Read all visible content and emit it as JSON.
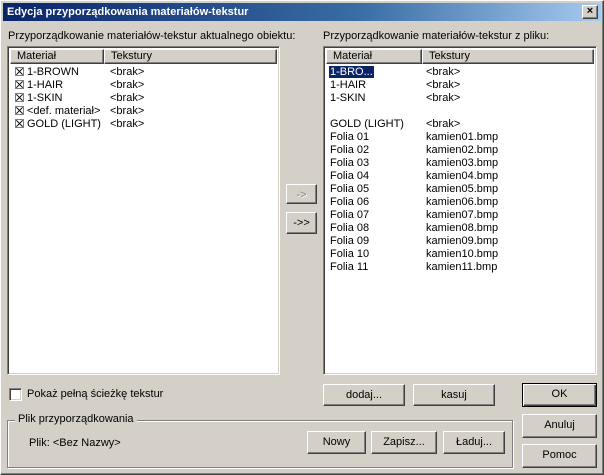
{
  "window": {
    "title": "Edycja przyporządkowania materiałów-tekstur",
    "close_glyph": "×"
  },
  "left_panel": {
    "label": "Przyporządkowanie materiałów-tekstur aktualnego obiektu:",
    "columns": [
      "Materiał",
      "Tekstury"
    ],
    "rows": [
      {
        "material": "1-BROWN",
        "texture": "<brak>",
        "checked": true
      },
      {
        "material": "1-HAIR",
        "texture": "<brak>",
        "checked": true
      },
      {
        "material": "1-SKIN",
        "texture": "<brak>",
        "checked": true
      },
      {
        "material": "<def. materiał>",
        "texture": "<brak>",
        "checked": true
      },
      {
        "material": "GOLD (LIGHT)",
        "texture": "<brak>",
        "checked": true
      }
    ]
  },
  "right_panel": {
    "label": "Przyporządkowanie materiałów-tekstur z pliku:",
    "columns": [
      "Materiał",
      "Tekstury"
    ],
    "rows": [
      {
        "material": "1-BRO...",
        "texture": "<brak>",
        "selected": true
      },
      {
        "material": "1-HAIR",
        "texture": "<brak>"
      },
      {
        "material": "1-SKIN",
        "texture": "<brak>"
      },
      {
        "material": "",
        "texture": ""
      },
      {
        "material": "GOLD (LIGHT)",
        "texture": "<brak>"
      },
      {
        "material": "Folia 01",
        "texture": "kamien01.bmp"
      },
      {
        "material": "Folia 02",
        "texture": "kamien02.bmp"
      },
      {
        "material": "Folia 03",
        "texture": "kamien03.bmp"
      },
      {
        "material": "Folia 04",
        "texture": "kamien04.bmp"
      },
      {
        "material": "Folia 05",
        "texture": "kamien05.bmp"
      },
      {
        "material": "Folia 06",
        "texture": "kamien06.bmp"
      },
      {
        "material": "Folia 07",
        "texture": "kamien07.bmp"
      },
      {
        "material": "Folia 08",
        "texture": "kamien08.bmp"
      },
      {
        "material": "Folia 09",
        "texture": "kamien09.bmp"
      },
      {
        "material": "Folia 10",
        "texture": "kamien10.bmp"
      },
      {
        "material": "Folia 11",
        "texture": "kamien11.bmp"
      }
    ]
  },
  "transfer": {
    "one_label": "->",
    "all_label": "->>"
  },
  "show_path": {
    "label": "Pokaż pełną ścieżkę tekstur",
    "checked": false
  },
  "file_group": {
    "title": "Plik przyporządkowania",
    "file_label": "Plik: <Bez Nazwy>"
  },
  "buttons": {
    "add": "dodaj...",
    "delete": "kasuj",
    "ok": "OK",
    "cancel": "Anuluj",
    "help": "Pomoc",
    "new": "Nowy",
    "save": "Zapisz...",
    "load": "Ładuj..."
  },
  "colors": {
    "title_start": "#0a246a",
    "title_end": "#a6caf0",
    "selection": "#0a246a",
    "face": "#d4d0c8"
  }
}
